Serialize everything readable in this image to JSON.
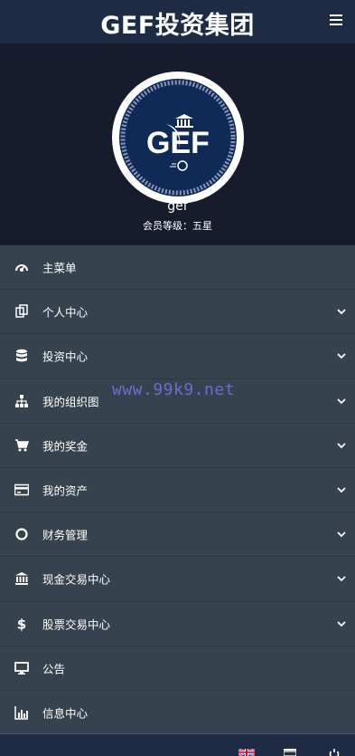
{
  "header": {
    "title": "GEF投资集团",
    "menu_icon": "hamburger-icon"
  },
  "profile": {
    "logo_text": "GEF",
    "username": "gef",
    "level": "会员等级：五星"
  },
  "menu": [
    {
      "label": "主菜单",
      "icon": "dashboard-icon",
      "has_submenu": false
    },
    {
      "label": "个人中心",
      "icon": "copy-icon",
      "has_submenu": true
    },
    {
      "label": "投资中心",
      "icon": "database-icon",
      "has_submenu": true
    },
    {
      "label": "我的组织图",
      "icon": "sitemap-icon",
      "has_submenu": true
    },
    {
      "label": "我的奖金",
      "icon": "cart-icon",
      "has_submenu": true
    },
    {
      "label": "我的资产",
      "icon": "credit-card-icon",
      "has_submenu": true
    },
    {
      "label": "财务管理",
      "icon": "circle-icon",
      "has_submenu": true
    },
    {
      "label": "现金交易中心",
      "icon": "bank-icon",
      "has_submenu": true
    },
    {
      "label": "股票交易中心",
      "icon": "dollar-icon",
      "has_submenu": true
    },
    {
      "label": "公告",
      "icon": "monitor-icon",
      "has_submenu": false
    },
    {
      "label": "信息中心",
      "icon": "bar-chart-icon",
      "has_submenu": false
    }
  ],
  "watermark": "www.99k9.net",
  "footer": {
    "icons": [
      "uk-flag-icon",
      "news-icon",
      "power-icon"
    ]
  },
  "colors": {
    "header": "#1d2b45",
    "profile_bg": "#171c2c",
    "menu_bg": "#36424d",
    "logo_bg": "#0f2a57"
  }
}
